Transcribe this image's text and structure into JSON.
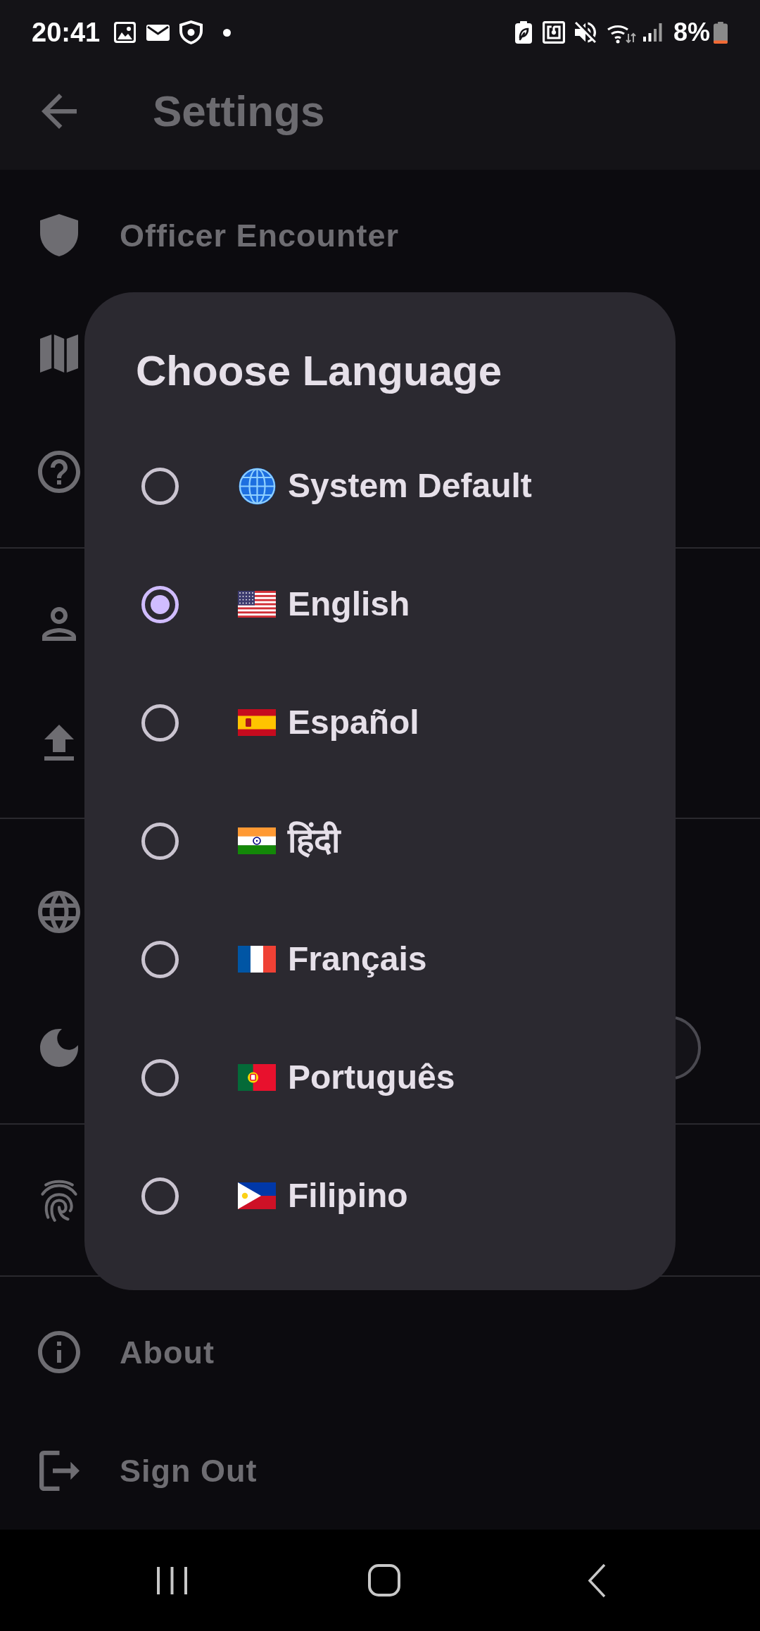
{
  "status_bar": {
    "time": "20:41",
    "battery": "8%"
  },
  "app_bar": {
    "title": "Settings"
  },
  "sections": [
    {
      "items": [
        {
          "kind": "shield",
          "label": "Officer Encounter"
        },
        {
          "kind": "map"
        },
        {
          "kind": "help"
        }
      ]
    },
    {
      "items": [
        {
          "kind": "person"
        },
        {
          "kind": "upload"
        }
      ]
    },
    {
      "items": [
        {
          "kind": "globe"
        },
        {
          "kind": "moon",
          "toggle": {
            "on": false
          }
        }
      ]
    },
    {
      "items": [
        {
          "kind": "fingerprint"
        }
      ]
    },
    {
      "items": [
        {
          "kind": "info",
          "label": "About"
        },
        {
          "kind": "logout",
          "label": "Sign Out"
        }
      ]
    }
  ],
  "dialog": {
    "title": "Choose Language",
    "options": [
      {
        "kind": "globe",
        "label": "System Default",
        "selected": false
      },
      {
        "kind": "usa",
        "label": "English",
        "selected": true
      },
      {
        "kind": "spain",
        "label": "Español",
        "selected": false
      },
      {
        "kind": "india",
        "label": "हिंदी",
        "selected": false
      },
      {
        "kind": "france",
        "label": "Français",
        "selected": false
      },
      {
        "kind": "portugal",
        "label": "Português",
        "selected": false
      },
      {
        "kind": "philippines",
        "label": "Filipino",
        "selected": false
      }
    ]
  }
}
